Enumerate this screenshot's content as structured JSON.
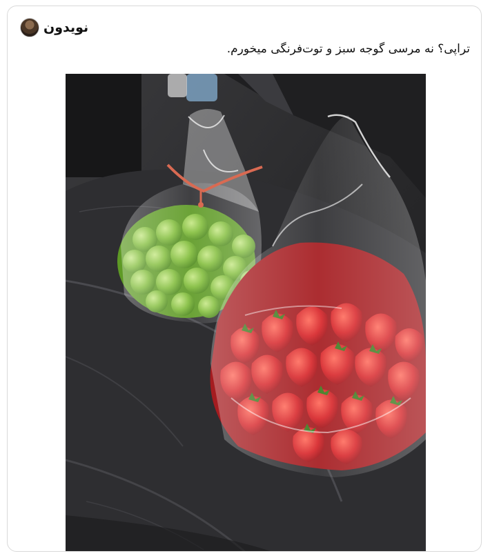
{
  "post": {
    "author": "نویدون",
    "avatar_icon": "avatar-photo",
    "text": "تراپی؟ نه مرسی گوجه سبز و توت‌فرنگی میخورم.",
    "photo": {
      "description_icon": "photo-green-plums-and-strawberries-in-bags-on-car-seat"
    }
  },
  "colors": {
    "card_border": "#d9d9d9",
    "text": "#111111",
    "seat": "#2b2b2d",
    "plum": "#7cb83a",
    "strawberry": "#d42a2a"
  }
}
